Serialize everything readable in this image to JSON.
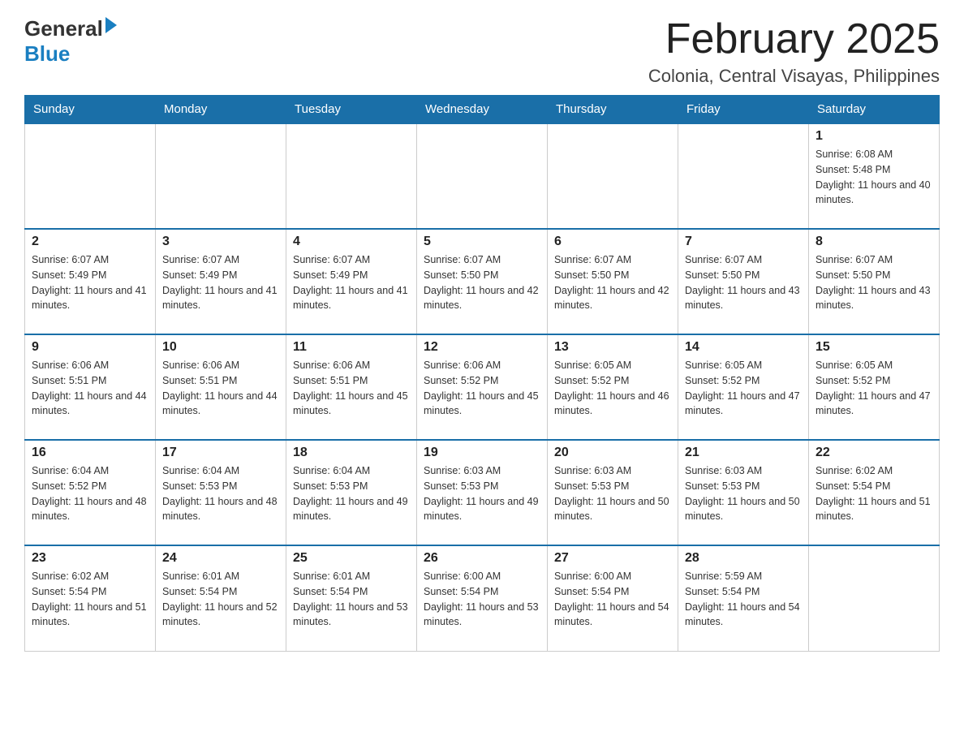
{
  "header": {
    "logo_general": "General",
    "logo_blue": "Blue",
    "month_title": "February 2025",
    "location": "Colonia, Central Visayas, Philippines"
  },
  "days_of_week": [
    "Sunday",
    "Monday",
    "Tuesday",
    "Wednesday",
    "Thursday",
    "Friday",
    "Saturday"
  ],
  "weeks": [
    [
      {
        "day": "",
        "sunrise": "",
        "sunset": "",
        "daylight": ""
      },
      {
        "day": "",
        "sunrise": "",
        "sunset": "",
        "daylight": ""
      },
      {
        "day": "",
        "sunrise": "",
        "sunset": "",
        "daylight": ""
      },
      {
        "day": "",
        "sunrise": "",
        "sunset": "",
        "daylight": ""
      },
      {
        "day": "",
        "sunrise": "",
        "sunset": "",
        "daylight": ""
      },
      {
        "day": "",
        "sunrise": "",
        "sunset": "",
        "daylight": ""
      },
      {
        "day": "1",
        "sunrise": "Sunrise: 6:08 AM",
        "sunset": "Sunset: 5:48 PM",
        "daylight": "Daylight: 11 hours and 40 minutes."
      }
    ],
    [
      {
        "day": "2",
        "sunrise": "Sunrise: 6:07 AM",
        "sunset": "Sunset: 5:49 PM",
        "daylight": "Daylight: 11 hours and 41 minutes."
      },
      {
        "day": "3",
        "sunrise": "Sunrise: 6:07 AM",
        "sunset": "Sunset: 5:49 PM",
        "daylight": "Daylight: 11 hours and 41 minutes."
      },
      {
        "day": "4",
        "sunrise": "Sunrise: 6:07 AM",
        "sunset": "Sunset: 5:49 PM",
        "daylight": "Daylight: 11 hours and 41 minutes."
      },
      {
        "day": "5",
        "sunrise": "Sunrise: 6:07 AM",
        "sunset": "Sunset: 5:50 PM",
        "daylight": "Daylight: 11 hours and 42 minutes."
      },
      {
        "day": "6",
        "sunrise": "Sunrise: 6:07 AM",
        "sunset": "Sunset: 5:50 PM",
        "daylight": "Daylight: 11 hours and 42 minutes."
      },
      {
        "day": "7",
        "sunrise": "Sunrise: 6:07 AM",
        "sunset": "Sunset: 5:50 PM",
        "daylight": "Daylight: 11 hours and 43 minutes."
      },
      {
        "day": "8",
        "sunrise": "Sunrise: 6:07 AM",
        "sunset": "Sunset: 5:50 PM",
        "daylight": "Daylight: 11 hours and 43 minutes."
      }
    ],
    [
      {
        "day": "9",
        "sunrise": "Sunrise: 6:06 AM",
        "sunset": "Sunset: 5:51 PM",
        "daylight": "Daylight: 11 hours and 44 minutes."
      },
      {
        "day": "10",
        "sunrise": "Sunrise: 6:06 AM",
        "sunset": "Sunset: 5:51 PM",
        "daylight": "Daylight: 11 hours and 44 minutes."
      },
      {
        "day": "11",
        "sunrise": "Sunrise: 6:06 AM",
        "sunset": "Sunset: 5:51 PM",
        "daylight": "Daylight: 11 hours and 45 minutes."
      },
      {
        "day": "12",
        "sunrise": "Sunrise: 6:06 AM",
        "sunset": "Sunset: 5:52 PM",
        "daylight": "Daylight: 11 hours and 45 minutes."
      },
      {
        "day": "13",
        "sunrise": "Sunrise: 6:05 AM",
        "sunset": "Sunset: 5:52 PM",
        "daylight": "Daylight: 11 hours and 46 minutes."
      },
      {
        "day": "14",
        "sunrise": "Sunrise: 6:05 AM",
        "sunset": "Sunset: 5:52 PM",
        "daylight": "Daylight: 11 hours and 47 minutes."
      },
      {
        "day": "15",
        "sunrise": "Sunrise: 6:05 AM",
        "sunset": "Sunset: 5:52 PM",
        "daylight": "Daylight: 11 hours and 47 minutes."
      }
    ],
    [
      {
        "day": "16",
        "sunrise": "Sunrise: 6:04 AM",
        "sunset": "Sunset: 5:52 PM",
        "daylight": "Daylight: 11 hours and 48 minutes."
      },
      {
        "day": "17",
        "sunrise": "Sunrise: 6:04 AM",
        "sunset": "Sunset: 5:53 PM",
        "daylight": "Daylight: 11 hours and 48 minutes."
      },
      {
        "day": "18",
        "sunrise": "Sunrise: 6:04 AM",
        "sunset": "Sunset: 5:53 PM",
        "daylight": "Daylight: 11 hours and 49 minutes."
      },
      {
        "day": "19",
        "sunrise": "Sunrise: 6:03 AM",
        "sunset": "Sunset: 5:53 PM",
        "daylight": "Daylight: 11 hours and 49 minutes."
      },
      {
        "day": "20",
        "sunrise": "Sunrise: 6:03 AM",
        "sunset": "Sunset: 5:53 PM",
        "daylight": "Daylight: 11 hours and 50 minutes."
      },
      {
        "day": "21",
        "sunrise": "Sunrise: 6:03 AM",
        "sunset": "Sunset: 5:53 PM",
        "daylight": "Daylight: 11 hours and 50 minutes."
      },
      {
        "day": "22",
        "sunrise": "Sunrise: 6:02 AM",
        "sunset": "Sunset: 5:54 PM",
        "daylight": "Daylight: 11 hours and 51 minutes."
      }
    ],
    [
      {
        "day": "23",
        "sunrise": "Sunrise: 6:02 AM",
        "sunset": "Sunset: 5:54 PM",
        "daylight": "Daylight: 11 hours and 51 minutes."
      },
      {
        "day": "24",
        "sunrise": "Sunrise: 6:01 AM",
        "sunset": "Sunset: 5:54 PM",
        "daylight": "Daylight: 11 hours and 52 minutes."
      },
      {
        "day": "25",
        "sunrise": "Sunrise: 6:01 AM",
        "sunset": "Sunset: 5:54 PM",
        "daylight": "Daylight: 11 hours and 53 minutes."
      },
      {
        "day": "26",
        "sunrise": "Sunrise: 6:00 AM",
        "sunset": "Sunset: 5:54 PM",
        "daylight": "Daylight: 11 hours and 53 minutes."
      },
      {
        "day": "27",
        "sunrise": "Sunrise: 6:00 AM",
        "sunset": "Sunset: 5:54 PM",
        "daylight": "Daylight: 11 hours and 54 minutes."
      },
      {
        "day": "28",
        "sunrise": "Sunrise: 5:59 AM",
        "sunset": "Sunset: 5:54 PM",
        "daylight": "Daylight: 11 hours and 54 minutes."
      },
      {
        "day": "",
        "sunrise": "",
        "sunset": "",
        "daylight": ""
      }
    ]
  ]
}
